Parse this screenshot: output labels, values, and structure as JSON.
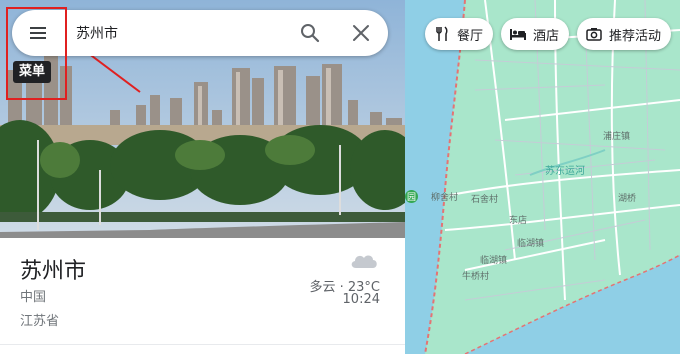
{
  "search": {
    "query": "苏州市"
  },
  "tooltip": {
    "menu_label": "菜单"
  },
  "place": {
    "title": "苏州市",
    "country": "中国",
    "province": "江苏省",
    "weather": "多云 · 23°C",
    "time": "10:24"
  },
  "chips": [
    {
      "label": "餐厅",
      "icon": "restaurant-icon"
    },
    {
      "label": "酒店",
      "icon": "hotel-icon"
    },
    {
      "label": "推荐活动",
      "icon": "camera-icon"
    }
  ],
  "map": {
    "labels": {
      "puzhuang": "浦庄镇",
      "suzhou_canal": "苏东运河",
      "xianghu": "湖桥",
      "liushe": "柳舍村",
      "shishe": "石舍村",
      "dongdian": "东店",
      "linhu": "临湖镇",
      "nianqiao": "牛桥村",
      "park": "园"
    }
  },
  "colors": {
    "map_land": "#a9e6cb",
    "map_water": "#8fcfe6",
    "annotation": "#e02020"
  }
}
